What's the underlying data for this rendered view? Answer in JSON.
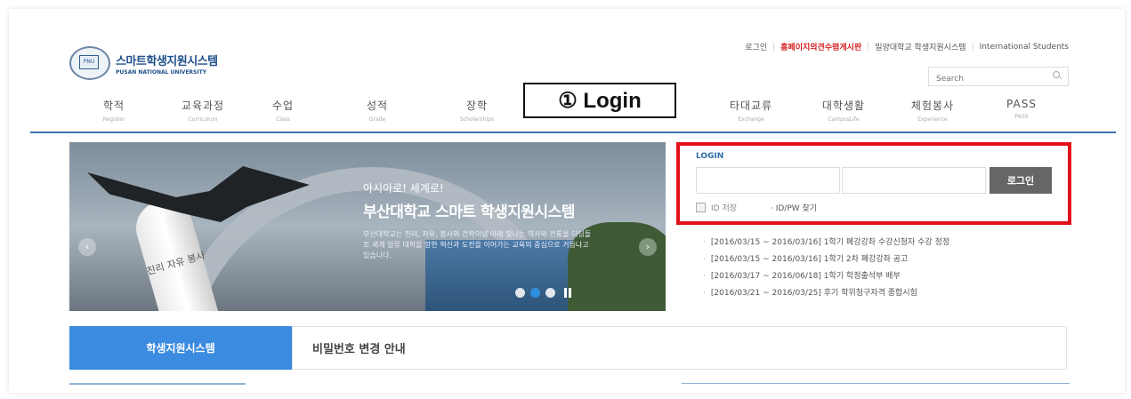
{
  "logo": {
    "title": "스마트학생지원시스템",
    "subtitle": "PUSAN NATIONAL UNIVERSITY",
    "seal_text": "PNU"
  },
  "utility_links": [
    {
      "label": "로그인",
      "highlight": false
    },
    {
      "label": "홈페이지의견수렴게시판",
      "highlight": true
    },
    {
      "label": "밀양대학교 학생지원시스템",
      "highlight": false
    },
    {
      "label": "International Students",
      "highlight": false
    }
  ],
  "search": {
    "placeholder": "Search",
    "icon": "search-icon"
  },
  "nav": [
    {
      "ko": "학적",
      "en": "Register"
    },
    {
      "ko": "교육과정",
      "en": "Curriculum"
    },
    {
      "ko": "수업",
      "en": "Class"
    },
    {
      "ko": "성적",
      "en": "Grade"
    },
    {
      "ko": "장학",
      "en": "Scholarships"
    },
    {
      "ko": "타대교류",
      "en": "Exchange"
    },
    {
      "ko": "대학생활",
      "en": "CampusLife"
    },
    {
      "ko": "체험봉사",
      "en": "Experience"
    },
    {
      "ko": "PASS",
      "en": "PASS"
    }
  ],
  "callout": {
    "label": "① Login"
  },
  "banner": {
    "title_small": "아시아로! 세계로!",
    "title": "부산대학교 스마트 학생지원시스템",
    "body": "부산대학교는 진리, 자유, 봉사의 건학이념 아래 빛나는 역사와 전통을 디딤돌로 세계 일류 대학을 향한 혁신과 도전을 이어가는 교육의 중심으로 거듭나고 있습니다.",
    "pillar_text": "진리 자유 봉사",
    "prev_arrow": "‹",
    "next_arrow": "›"
  },
  "login": {
    "heading": "LOGIN",
    "button": "로그인",
    "save_id": "ID 저장",
    "find": "· ID/PW 찾기",
    "accent_color": "#e3101a"
  },
  "notices": [
    "[2016/03/15 ~ 2016/03/16] 1학기 폐강강좌 수강신청자 수강 정정",
    "[2016/03/15 ~ 2016/03/16] 1학기 2차 폐강강좌 공고",
    "[2016/03/17 ~ 2016/06/18] 1학기 학정출석부 배부",
    "[2016/03/21 ~ 2016/03/25] 후기 학위청구자격 종합시험"
  ],
  "tabs": {
    "active": "학생지원시스템",
    "inactive": "비밀번호 변경 안내"
  },
  "colors": {
    "nav_line": "#3b6fad",
    "tab_active": "#3b8be0",
    "login_btn": "#666666"
  }
}
